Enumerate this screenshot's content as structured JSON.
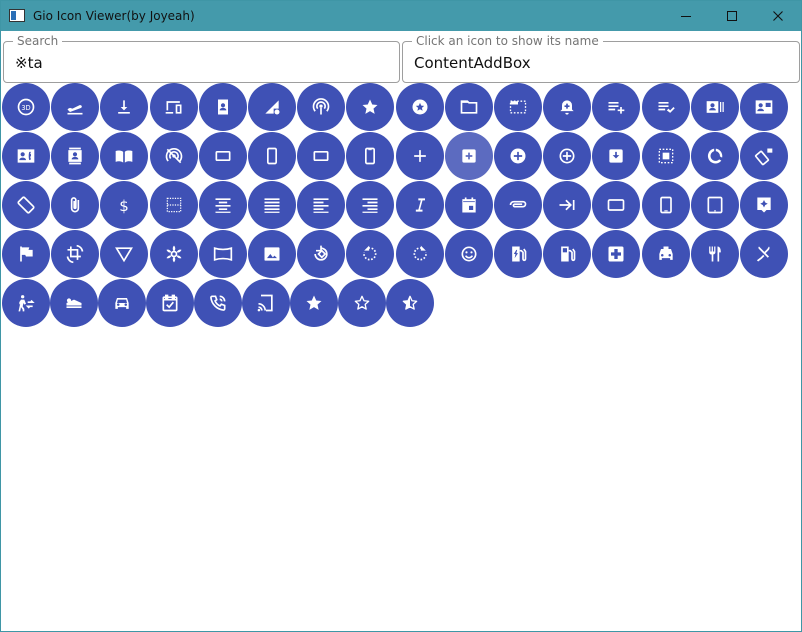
{
  "window": {
    "title": "Gio Icon Viewer(by Joyeah)"
  },
  "search": {
    "label": "Search",
    "value": "※ta"
  },
  "selected": {
    "label": "Click an icon to show its name",
    "value": "ContentAddBox"
  },
  "colors": {
    "titlebar": "#449aab",
    "icon_bg": "#3f51b5",
    "icon_selected": "#5c6bc0",
    "icon_fg": "#ffffff"
  },
  "icons": [
    "3d-rotation-icon",
    "flight-takeoff-icon",
    "download-icon",
    "devices-icon",
    "contact-page-icon",
    "signal-settings-icon",
    "wifi-tethering-icon",
    "star-icon",
    "stars-icon",
    "folder-icon",
    "tab-unselected-icon",
    "alarm-add-icon",
    "playlist-add-icon",
    "playlist-check-icon",
    "contacts-card-icon",
    "contact-mail-icon",
    "contact-phone-icon",
    "contacts-book-icon",
    "import-contacts-icon",
    "portable-wifi-off-icon",
    "crop-landscape-icon",
    "stay-portrait-icon",
    "crop-landscape-icon",
    "stay-primary-portrait-icon",
    "add-icon",
    "add-box-icon",
    "add-circle-icon",
    "add-circle-outline-icon",
    "move-to-inbox-icon",
    "select-all-icon",
    "data-usage-icon",
    "screen-lock-rotation-icon",
    "screen-rotation-icon",
    "attach-file-icon",
    "attach-money-icon",
    "border-outer-icon",
    "format-align-center-icon",
    "format-align-justify-icon",
    "format-align-left-icon",
    "format-align-right-icon",
    "format-italic-icon",
    "insert-invitation-icon",
    "attachment-icon",
    "keyboard-tab-icon",
    "stay-landscape-icon",
    "tablet-android-icon",
    "tablet-icon",
    "assistant-icon",
    "assistant-photo-icon",
    "crop-rotate-icon",
    "details-icon",
    "filter-vintage-icon",
    "panorama-icon",
    "photo-icon",
    "rotate-90-icon",
    "rotate-left-icon",
    "rotate-right-icon",
    "tag-faces-icon",
    "ev-station-icon",
    "local-gas-station-icon",
    "local-hospital-icon",
    "local-taxi-icon",
    "restaurant-icon",
    "restaurant-menu-icon",
    "transfer-within-station-icon",
    "airline-seat-flat-icon",
    "directions-car-icon",
    "event-available-icon",
    "phone-in-talk-icon",
    "cast-connected-icon",
    "star-icon",
    "star-border-icon",
    "star-half-icon"
  ]
}
